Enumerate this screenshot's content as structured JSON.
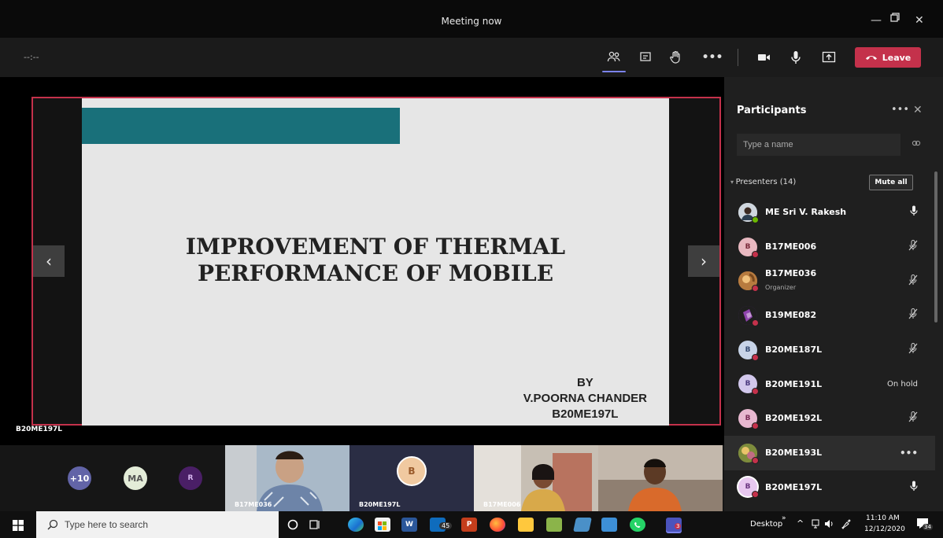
{
  "window": {
    "title": "Meeting now"
  },
  "toolbar": {
    "timer": "--:--",
    "leave_label": "Leave"
  },
  "slide": {
    "title_line1": "IMPROVEMENT OF THERMAL",
    "title_line2": "PERFORMANCE OF MOBILE",
    "by_line": "BY",
    "author": "V.POORNA CHANDER",
    "roll": "B20ME197L"
  },
  "stage": {
    "speaker_label": "B20ME197L"
  },
  "participants": {
    "title": "Participants",
    "search_placeholder": "Type a name",
    "presenters_label": "Presenters (14)",
    "mute_all_label": "Mute all",
    "list": [
      {
        "name": "ME Sri V. Rakesh",
        "sub": "",
        "status": "",
        "initial": ""
      },
      {
        "name": "B17ME006",
        "sub": "",
        "status": "",
        "initial": "B"
      },
      {
        "name": "B17ME036",
        "sub": "Organizer",
        "status": "",
        "initial": ""
      },
      {
        "name": "B19ME082",
        "sub": "",
        "status": "",
        "initial": "B"
      },
      {
        "name": "B20ME187L",
        "sub": "",
        "status": "",
        "initial": "B"
      },
      {
        "name": "B20ME191L",
        "sub": "",
        "status": "On hold",
        "initial": "B"
      },
      {
        "name": "B20ME192L",
        "sub": "",
        "status": "",
        "initial": "B"
      },
      {
        "name": "B20ME193L",
        "sub": "",
        "status": "",
        "initial": ""
      },
      {
        "name": "B20ME197L",
        "sub": "",
        "status": "",
        "initial": "B"
      }
    ]
  },
  "gallery": {
    "overflow_count": "+10",
    "ma_initials": "MA",
    "r_initial": "R",
    "tile1_label": "B17ME036",
    "tile2_label": "B20ME197L",
    "tile2_initial": "B",
    "tile3_label": "B17ME006"
  },
  "taskbar": {
    "search_placeholder": "Type here to search",
    "desktop_label": "Desktop",
    "time": "11:10 AM",
    "date": "12/12/2020",
    "notif_count": "34",
    "badge_45": "45",
    "badge_3": "3"
  },
  "colors": {
    "accent": "#7b83eb",
    "leave": "#c4314b",
    "slide_bar": "#19707a",
    "panel_bg": "#1f1f1f"
  }
}
